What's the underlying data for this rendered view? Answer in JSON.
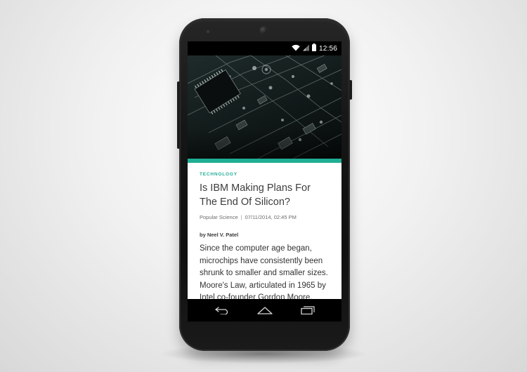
{
  "status_bar": {
    "time": "12:56",
    "icons": [
      "wifi-icon",
      "cell-signal-icon",
      "battery-icon"
    ]
  },
  "hero": {
    "image_subject": "circuit-board-photo"
  },
  "article": {
    "category": "TECHNOLOGY",
    "headline": "Is IBM Making Plans For The End Of Silicon?",
    "source": "Popular Science",
    "separator": "|",
    "datetime": "07/11/2014, 02:45 PM",
    "byline": "by Neel V. Patel",
    "body": "Since the computer age began, microchips have consistently been shrunk to smaller and smaller sizes. Moore's Law, articulated in 1965 by Intel co-founder Gordon Moore,"
  },
  "nav": {
    "buttons": [
      "back-icon",
      "home-icon",
      "recents-icon"
    ]
  },
  "colors": {
    "accent": "#1fae94",
    "category_text": "#1fae94",
    "background": "#efefef",
    "phone_body": "#161616"
  }
}
